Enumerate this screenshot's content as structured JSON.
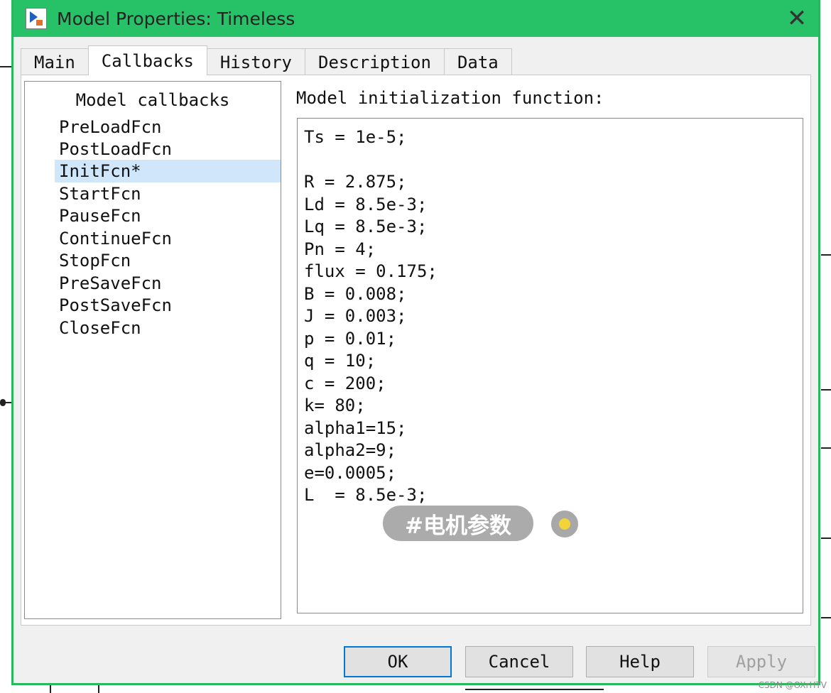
{
  "window": {
    "title": "Model Properties: Timeless",
    "close_glyph": "✕"
  },
  "tabs": [
    {
      "label": "Main"
    },
    {
      "label": "Callbacks",
      "active": true
    },
    {
      "label": "History"
    },
    {
      "label": "Description"
    },
    {
      "label": "Data"
    }
  ],
  "callbacks": {
    "list_title": "Model callbacks",
    "items": [
      "PreLoadFcn",
      "PostLoadFcn",
      "InitFcn*",
      "StartFcn",
      "PauseFcn",
      "ContinueFcn",
      "StopFcn",
      "PreSaveFcn",
      "PostSaveFcn",
      "CloseFcn"
    ],
    "selected": "InitFcn*"
  },
  "editor": {
    "label": "Model initialization function:",
    "lines": [
      "Ts = 1e-5;",
      "",
      "R = 2.875;",
      "Ld = 8.5e-3;",
      "Lq = 8.5e-3;",
      "Pn = 4;",
      "flux = 0.175;",
      "B = 0.008;",
      "J = 0.003;",
      "p = 0.01;",
      "q = 10;",
      "c = 200;",
      "k= 80;",
      "alpha1=15;",
      "alpha2=9;",
      "e=0.0005;",
      "L  = 8.5e-3;"
    ]
  },
  "overlay": {
    "tag_text": "#电机参数"
  },
  "buttons": {
    "ok": "OK",
    "cancel": "Cancel",
    "help": "Help",
    "apply": "Apply"
  },
  "watermark": "CSDN @OXrHTV",
  "colors": {
    "titlebar": "#27c267",
    "selection": "#cfe6fb",
    "default_button_border": "#0078d7"
  }
}
